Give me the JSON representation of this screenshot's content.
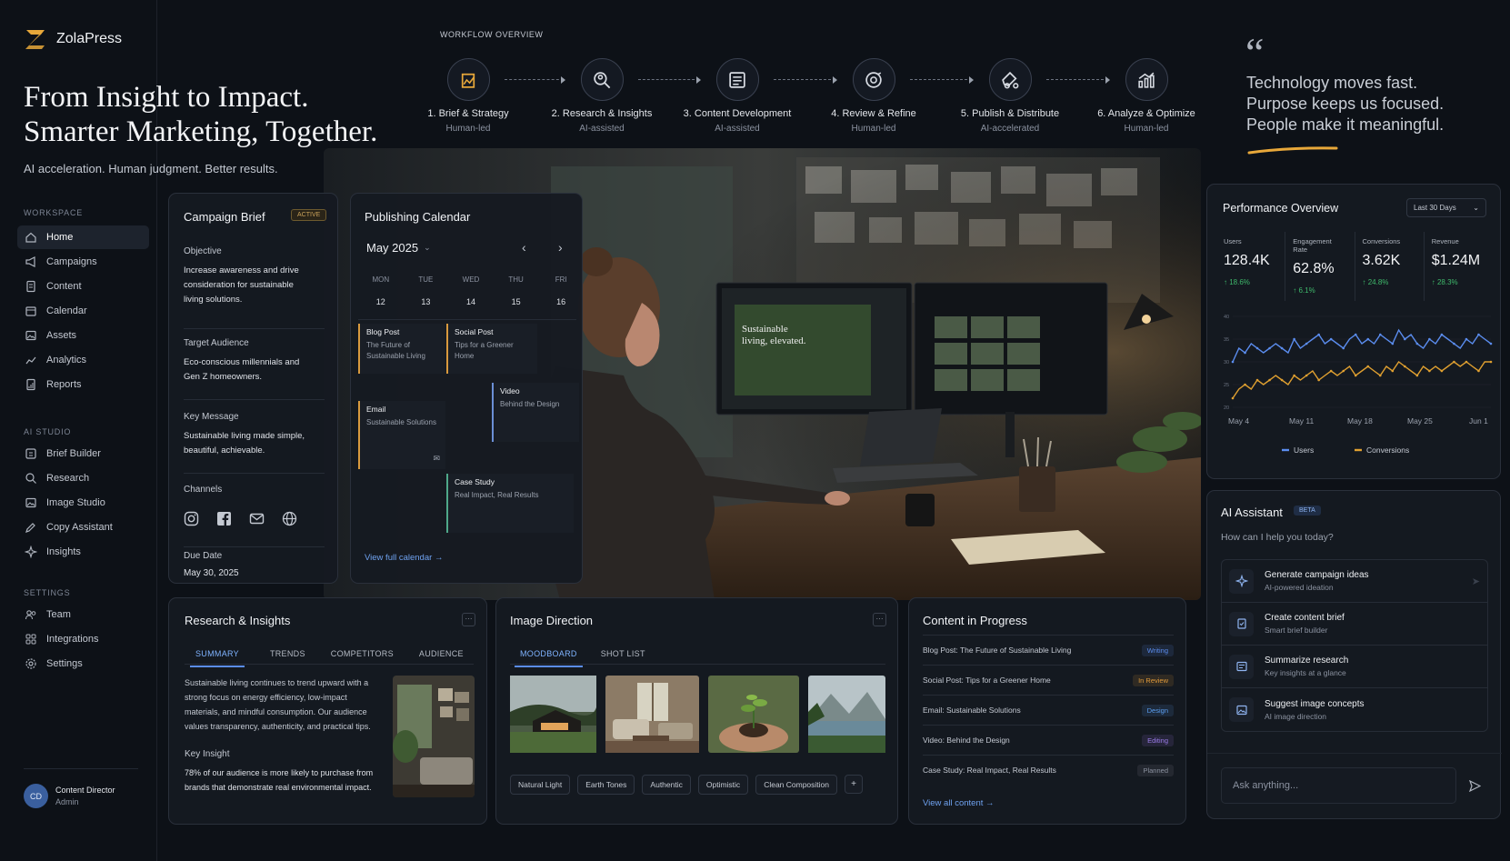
{
  "brand": {
    "name": "ZolaPress"
  },
  "hero": {
    "title_line1": "From Insight to Impact.",
    "title_line2": "Smarter Marketing, Together.",
    "subtitle": "AI acceleration. Human judgment. Better results."
  },
  "sidebar": {
    "workspace_label": "WORKSPACE",
    "workspace": [
      {
        "label": "Home",
        "icon": "home-icon"
      },
      {
        "label": "Campaigns",
        "icon": "megaphone-icon"
      },
      {
        "label": "Content",
        "icon": "document-icon"
      },
      {
        "label": "Calendar",
        "icon": "calendar-icon"
      },
      {
        "label": "Assets",
        "icon": "image-icon"
      },
      {
        "label": "Analytics",
        "icon": "chart-icon"
      },
      {
        "label": "Reports",
        "icon": "report-icon"
      }
    ],
    "ai_label": "AI STUDIO",
    "ai": [
      {
        "label": "Brief Builder",
        "icon": "builder-icon"
      },
      {
        "label": "Research",
        "icon": "search-icon"
      },
      {
        "label": "Image Studio",
        "icon": "image-icon"
      },
      {
        "label": "Copy Assistant",
        "icon": "pen-icon"
      },
      {
        "label": "Insights",
        "icon": "sparkle-icon"
      }
    ],
    "settings_label": "SETTINGS",
    "settings": [
      {
        "label": "Team",
        "icon": "team-icon"
      },
      {
        "label": "Integrations",
        "icon": "grid-icon"
      },
      {
        "label": "Settings",
        "icon": "gear-icon"
      }
    ],
    "user": {
      "initials": "CD",
      "name": "Content Director",
      "role": "Admin"
    }
  },
  "workflow": {
    "label": "WORKFLOW OVERVIEW",
    "steps": [
      {
        "label": "1. Brief & Strategy",
        "sub": "Human-led",
        "icon": "strategy-icon"
      },
      {
        "label": "2. Research & Insights",
        "sub": "AI-assisted",
        "icon": "research-icon"
      },
      {
        "label": "3. Content Development",
        "sub": "AI-assisted",
        "icon": "content-icon"
      },
      {
        "label": "4. Review & Refine",
        "sub": "Human-led",
        "icon": "review-icon"
      },
      {
        "label": "5. Publish & Distribute",
        "sub": "AI-accelerated",
        "icon": "publish-icon"
      },
      {
        "label": "6. Analyze & Optimize",
        "sub": "Human-led",
        "icon": "analyze-icon"
      }
    ]
  },
  "quote": {
    "line1": "Technology moves fast.",
    "line2": "Purpose keeps us focused.",
    "line3": "People make it meaningful."
  },
  "brief": {
    "title": "Campaign Brief",
    "status": "ACTIVE",
    "objective_label": "Objective",
    "objective": "Increase awareness and drive consideration for sustainable living solutions.",
    "audience_label": "Target Audience",
    "audience": "Eco-conscious millennials and Gen Z homeowners.",
    "message_label": "Key Message",
    "message": "Sustainable living made simple, beautiful, achievable.",
    "channels_label": "Channels",
    "channels": [
      "instagram-icon",
      "facebook-icon",
      "email-icon",
      "globe-icon"
    ],
    "due_label": "Due Date",
    "due": "May 30, 2025"
  },
  "calendar": {
    "title": "Publishing Calendar",
    "month": "May 2025",
    "days": [
      "MON",
      "TUE",
      "WED",
      "THU",
      "FRI"
    ],
    "dates": [
      "12",
      "13",
      "14",
      "15",
      "16"
    ],
    "events": [
      {
        "title": "Blog Post",
        "desc": "The Future of Sustainable Living",
        "color": "#d99a3e"
      },
      {
        "title": "Social Post",
        "desc": "Tips for a Greener Home",
        "color": "#d99a3e"
      },
      {
        "title": "Video",
        "desc": "Behind the Design",
        "color": "#6b8fd6"
      },
      {
        "title": "Email",
        "desc": "Sustainable Solutions",
        "color": "#d99a3e"
      },
      {
        "title": "Case Study",
        "desc": "Real Impact, Real Results",
        "color": "#4fa88a"
      }
    ],
    "link": "View full calendar"
  },
  "performance": {
    "title": "Performance Overview",
    "range": "Last 30 Days",
    "metrics": [
      {
        "label": "Users",
        "value": "128.4K",
        "change": "18.6%"
      },
      {
        "label": "Engagement Rate",
        "value": "62.8%",
        "change": "6.1%"
      },
      {
        "label": "Conversions",
        "value": "3.62K",
        "change": "24.8%"
      },
      {
        "label": "Revenue",
        "value": "$1.24M",
        "change": "28.3%"
      }
    ],
    "up_color": "#3fb96b"
  },
  "chart_data": {
    "type": "line",
    "categories": [
      "May 4",
      "May 11",
      "May 18",
      "May 25",
      "Jun 1"
    ],
    "yticks": [
      "40",
      "35",
      "30",
      "25",
      "20"
    ],
    "ylim": [
      20,
      40
    ],
    "legend_position": "bottom",
    "series": [
      {
        "name": "Users",
        "color": "#5b8def",
        "values": [
          30,
          33,
          32,
          34,
          33,
          32,
          33,
          34,
          33,
          32,
          35,
          33,
          34,
          35,
          36,
          34,
          35,
          34,
          33,
          35,
          36,
          34,
          35,
          34,
          36,
          35,
          34,
          37,
          35,
          36,
          34,
          33,
          35,
          34,
          36,
          35,
          34,
          33,
          35,
          34,
          36,
          35,
          34
        ]
      },
      {
        "name": "Conversions",
        "color": "#e0a030",
        "values": [
          22,
          24,
          25,
          24,
          26,
          25,
          26,
          27,
          26,
          25,
          27,
          26,
          27,
          28,
          26,
          27,
          28,
          27,
          28,
          29,
          27,
          28,
          29,
          28,
          27,
          29,
          28,
          30,
          29,
          28,
          27,
          29,
          28,
          29,
          28,
          29,
          30,
          29,
          30,
          29,
          28,
          30,
          30
        ]
      }
    ]
  },
  "assistant": {
    "title": "AI Assistant",
    "badge": "BETA",
    "prompt": "How can I help you today?",
    "items": [
      {
        "title": "Generate campaign ideas",
        "sub": "AI-powered ideation",
        "icon": "sparkle-icon"
      },
      {
        "title": "Create content brief",
        "sub": "Smart brief builder",
        "icon": "brief-icon"
      },
      {
        "title": "Summarize research",
        "sub": "Key insights at a glance",
        "icon": "summary-icon"
      },
      {
        "title": "Suggest image concepts",
        "sub": "AI image direction",
        "icon": "image-icon"
      }
    ],
    "placeholder": "Ask anything..."
  },
  "research": {
    "title": "Research & Insights",
    "tabs": [
      "SUMMARY",
      "TRENDS",
      "COMPETITORS",
      "AUDIENCE"
    ],
    "summary": "Sustainable living continues to trend upward with a strong focus on energy efficiency, low-impact materials, and mindful consumption. Our audience values transparency, authenticity, and practical tips.",
    "insight_label": "Key Insight",
    "insight": "78% of our audience is more likely to purchase from brands that demonstrate real environmental impact."
  },
  "image_direction": {
    "title": "Image Direction",
    "tabs": [
      "MOODBOARD",
      "SHOT LIST"
    ],
    "tags": [
      "Natural Light",
      "Earth Tones",
      "Authentic",
      "Optimistic",
      "Clean Composition"
    ],
    "add": "+"
  },
  "content_progress": {
    "title": "Content in Progress",
    "items": [
      {
        "name": "Blog Post: The Future of Sustainable Living",
        "status": "Writing",
        "color": "#5b8def"
      },
      {
        "name": "Social Post: Tips for a Greener Home",
        "status": "In Review",
        "color": "#e09a3a"
      },
      {
        "name": "Email: Sustainable Solutions",
        "status": "Design",
        "color": "#5b9ef0"
      },
      {
        "name": "Video: Behind the Design",
        "status": "Editing",
        "color": "#9a7be8"
      },
      {
        "name": "Case Study: Real Impact, Real Results",
        "status": "Planned",
        "color": "#8b92a0"
      }
    ],
    "link": "View all content"
  },
  "colors": {
    "accent": "#e8a83a",
    "blue": "#5b8def",
    "bg": "#0d1117"
  }
}
